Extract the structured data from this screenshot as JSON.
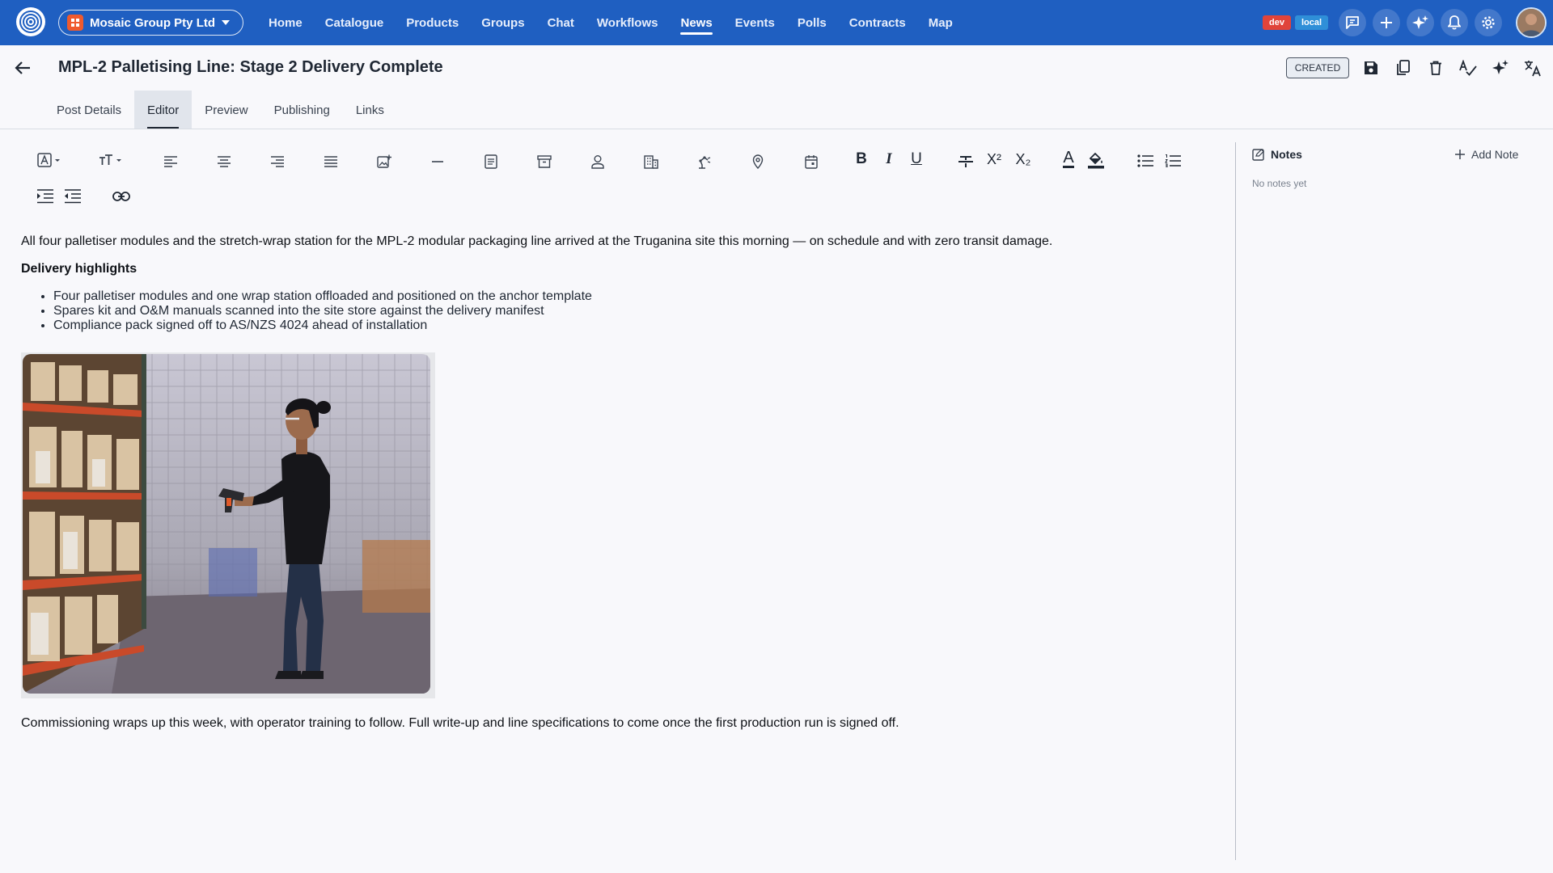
{
  "app": {
    "org_name": "Mosaic Group Pty Ltd",
    "nav": [
      {
        "label": "Home",
        "active": false
      },
      {
        "label": "Catalogue",
        "active": false
      },
      {
        "label": "Products",
        "active": false
      },
      {
        "label": "Groups",
        "active": false
      },
      {
        "label": "Chat",
        "active": false
      },
      {
        "label": "Workflows",
        "active": false
      },
      {
        "label": "News",
        "active": true
      },
      {
        "label": "Events",
        "active": false
      },
      {
        "label": "Polls",
        "active": false
      },
      {
        "label": "Contracts",
        "active": false
      },
      {
        "label": "Map",
        "active": false
      }
    ],
    "env_badges": {
      "dev": "dev",
      "local": "local"
    },
    "colors": {
      "topbar": "#1f5fc1",
      "dev_badge": "#e0443a",
      "local_badge": "#2f8fd8",
      "org_badge": "#ef5a2e"
    },
    "top_icons": [
      "feedback-icon",
      "plus-icon",
      "ai-sparkle-icon",
      "bell-icon",
      "gear-icon"
    ]
  },
  "header": {
    "title": "MPL-2 Palletising Line: Stage 2 Delivery Complete",
    "status": "CREATED",
    "actions": [
      "save-icon",
      "duplicate-icon",
      "delete-icon",
      "spellcheck-icon",
      "ai-sparkle-icon",
      "translate-icon"
    ]
  },
  "tabs": [
    {
      "label": "Post Details",
      "active": false
    },
    {
      "label": "Editor",
      "active": true
    },
    {
      "label": "Preview",
      "active": false
    },
    {
      "label": "Publishing",
      "active": false
    },
    {
      "label": "Links",
      "active": false
    }
  ],
  "toolbar": {
    "bold": "B",
    "italic": "I",
    "underline": "U",
    "superscript": "X²",
    "subscript": "X₂",
    "text_color": "A"
  },
  "content": {
    "intro": "All four palletiser modules and the stretch-wrap station for the MPL-2 modular packaging line arrived at the Truganina site this morning — on schedule and with zero transit damage.",
    "heading": "Delivery highlights",
    "bullets": [
      "Four palletiser modules and one wrap station offloaded and positioned on the anchor template",
      "Spares kit and O&M manuals scanned into the site store against the delivery manifest",
      "Compliance pack signed off to AS/NZS 4024 ahead of installation"
    ],
    "outro": "Commissioning wraps up this week, with operator training to follow. Full write-up and line specifications to come once the first production run is signed off."
  },
  "notes": {
    "title": "Notes",
    "add_label": "Add Note",
    "empty": "No notes yet"
  }
}
